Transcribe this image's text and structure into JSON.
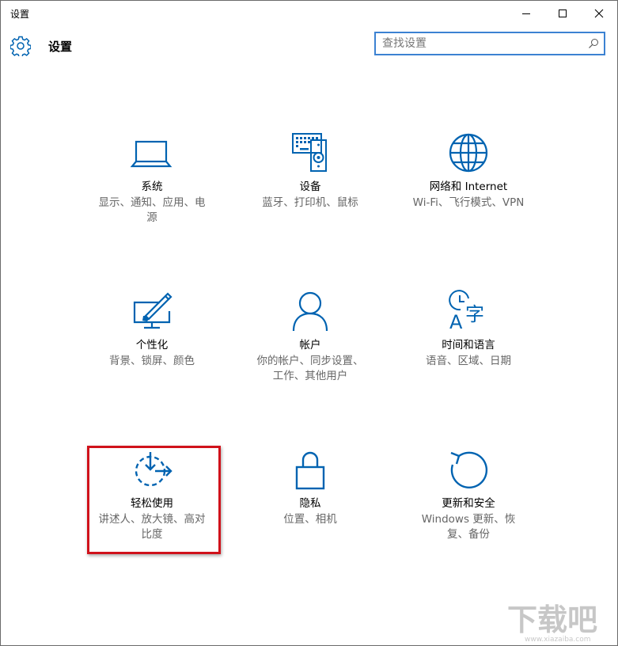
{
  "window": {
    "title": "设置"
  },
  "header": {
    "title": "设置",
    "icon": "gear-icon"
  },
  "search": {
    "placeholder": "查找设置",
    "value": ""
  },
  "colors": {
    "accent": "#0063b1",
    "highlight_border": "#d0121b",
    "search_border": "#3c82d2",
    "description_text": "#666666"
  },
  "tiles": [
    {
      "name": "系统",
      "desc_line1": "显示、通知、应用、电",
      "desc_line2": "源",
      "icon": "laptop-icon"
    },
    {
      "name": "设备",
      "desc_line1": "蓝牙、打印机、鼠标",
      "desc_line2": "",
      "icon": "keyboard-speaker-icon"
    },
    {
      "name": "网络和 Internet",
      "desc_line1": "Wi-Fi、飞行模式、VPN",
      "desc_line2": "",
      "icon": "globe-icon"
    },
    {
      "name": "个性化",
      "desc_line1": "背景、锁屏、颜色",
      "desc_line2": "",
      "icon": "monitor-brush-icon"
    },
    {
      "name": "帐户",
      "desc_line1": "你的帐户、同步设置、",
      "desc_line2": "工作、其他用户",
      "icon": "person-icon"
    },
    {
      "name": "时间和语言",
      "desc_line1": "语音、区域、日期",
      "desc_line2": "",
      "icon": "clock-language-icon"
    },
    {
      "name": "轻松使用",
      "desc_line1": "讲述人、放大镜、高对",
      "desc_line2": "比度",
      "icon": "ease-of-access-icon"
    },
    {
      "name": "隐私",
      "desc_line1": "位置、相机",
      "desc_line2": "",
      "icon": "lock-icon"
    },
    {
      "name": "更新和安全",
      "desc_line1": "Windows 更新、恢",
      "desc_line2": "复、备份",
      "icon": "refresh-icon"
    }
  ],
  "watermark": {
    "text": "下载吧",
    "url_text": "www.xiazaiba.com"
  }
}
